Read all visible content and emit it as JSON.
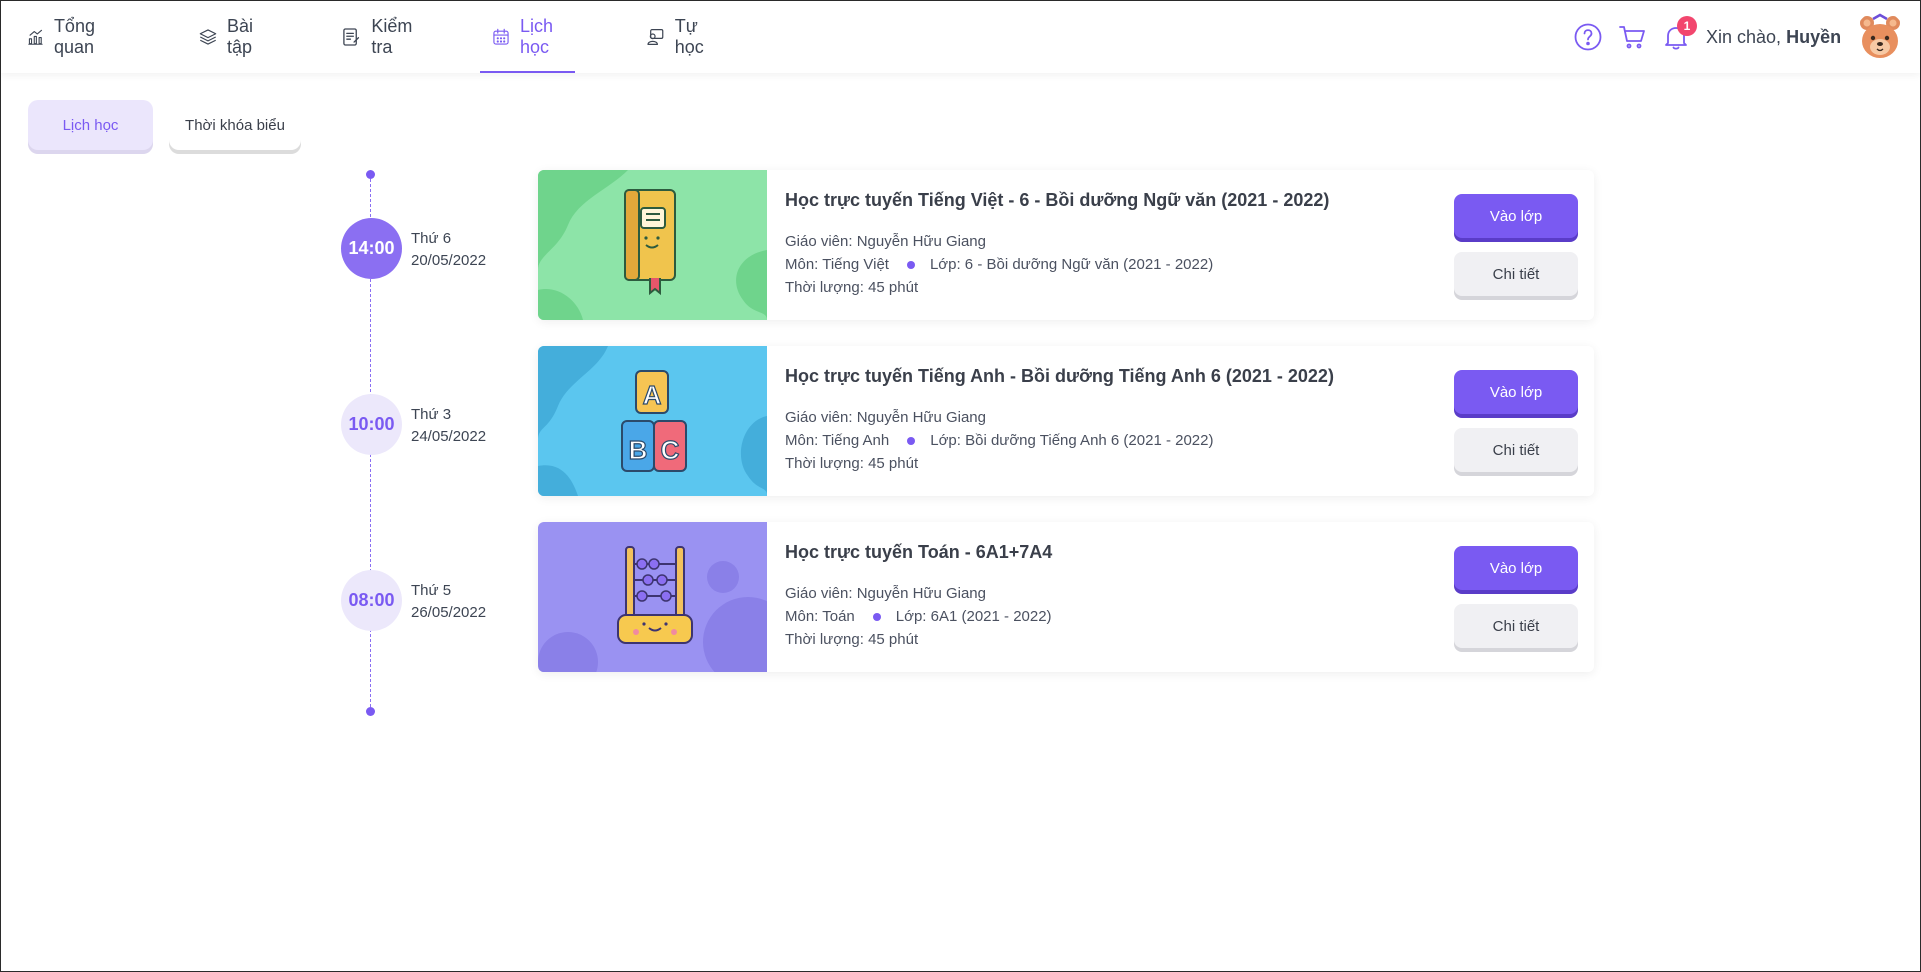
{
  "nav": {
    "items": [
      {
        "label": "Tổng quan",
        "icon": "chart-icon"
      },
      {
        "label": "Bài tập",
        "icon": "layers-icon"
      },
      {
        "label": "Kiểm tra",
        "icon": "test-icon"
      },
      {
        "label": "Lịch học",
        "icon": "calendar-icon",
        "active": true
      },
      {
        "label": "Tự học",
        "icon": "self-study-icon"
      }
    ]
  },
  "header": {
    "notification_count": "1",
    "greeting_prefix": "Xin chào,",
    "user_name": "Huyền"
  },
  "tabs": [
    {
      "label": "Lịch học",
      "active": true
    },
    {
      "label": "Thời khóa biểu",
      "active": false
    }
  ],
  "schedule": [
    {
      "time": "14:00",
      "weekday": "Thứ 6",
      "date": "20/05/2022",
      "title": "Học trực tuyến Tiếng Việt - 6 - Bồi dưỡng Ngữ văn (2021 - 2022)",
      "teacher": "Giáo viên: Nguyễn Hữu Giang",
      "subject": "Môn: Tiếng Việt",
      "class": "Lớp: 6 - Bồi dưỡng Ngữ văn (2021 - 2022)",
      "duration": "Thời lượng: 45 phút",
      "enter_label": "Vào lớp",
      "detail_label": "Chi tiết"
    },
    {
      "time": "10:00",
      "weekday": "Thứ 3",
      "date": "24/05/2022",
      "title": "Học trực tuyến Tiếng Anh - Bồi dưỡng Tiếng Anh 6 (2021 - 2022)",
      "teacher": "Giáo viên: Nguyễn Hữu Giang",
      "subject": "Môn: Tiếng Anh",
      "class": "Lớp: Bồi dưỡng Tiếng Anh 6 (2021 - 2022)",
      "duration": "Thời lượng: 45 phút",
      "enter_label": "Vào lớp",
      "detail_label": "Chi tiết"
    },
    {
      "time": "08:00",
      "weekday": "Thứ 5",
      "date": "26/05/2022",
      "title": "Học trực tuyến Toán - 6A1+7A4",
      "teacher": "Giáo viên: Nguyễn Hữu Giang",
      "subject": "Môn: Toán",
      "class": "Lớp: 6A1 (2021 - 2022)",
      "duration": "Thời lượng: 45 phút",
      "enter_label": "Vào lớp",
      "detail_label": "Chi tiết"
    }
  ],
  "colors": {
    "accent": "#7a5af2",
    "accent_soft": "#ece8fb",
    "badge": "#f2466e",
    "thumb_green": "#8de4a8",
    "thumb_blue": "#5bc6ef",
    "thumb_purple": "#9a92f2"
  }
}
